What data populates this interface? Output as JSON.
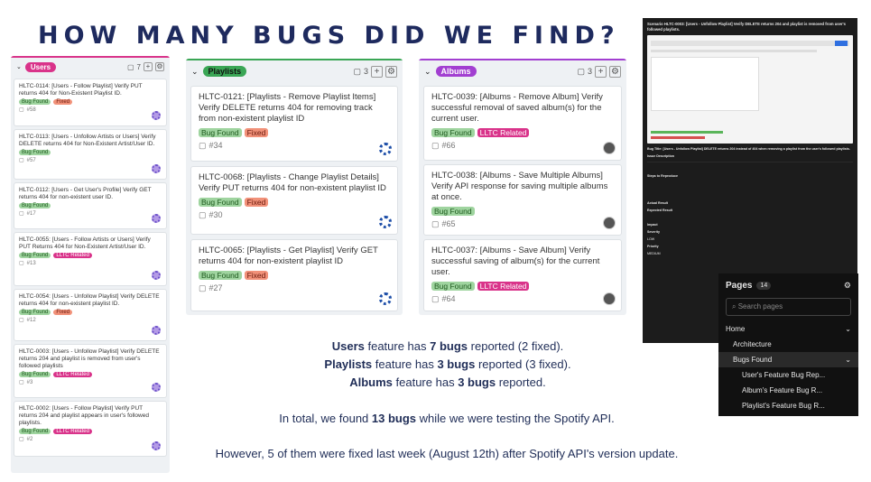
{
  "title": "HOW MANY BUGS DID WE FIND?",
  "columns": [
    {
      "label": "Users",
      "count": "7",
      "color": "#d9338a",
      "cards": [
        {
          "title": "HLTC-0114: [Users - Follow Playlist] Verify PUT returns 404 for Non-Existent Playlist ID.",
          "tags": [
            "Bug Found",
            "Fixed"
          ],
          "id": "#58"
        },
        {
          "title": "HLTC-0113: [Users - Unfollow Artists or Users] Verify DELETE returns 404 for Non-Existent Artist/User ID.",
          "tags": [
            "Bug Found"
          ],
          "id": "#57"
        },
        {
          "title": "HLTC-0112: [Users - Get User's Profile] Verify GET returns 404 for non-existent user ID.",
          "tags": [
            "Bug Found"
          ],
          "id": "#17"
        },
        {
          "title": "HLTC-0055: [Users - Follow Artists or Users] Verify PUT Returns 404 for Non-Existent Artist/User ID.",
          "tags": [
            "Bug Found",
            "LLTC Related"
          ],
          "id": "#13"
        },
        {
          "title": "HLTC-0054: [Users - Unfollow Playlist] Verify DELETE returns 404 for non-existent playlist ID.",
          "tags": [
            "Bug Found",
            "Fixed"
          ],
          "id": "#12"
        },
        {
          "title": "HLTC-0003: [Users - Unfollow Playlist] Verify DELETE returns 204 and playlist is removed from user's followed playlists",
          "tags": [
            "Bug Found",
            "LLTC Related"
          ],
          "id": "#3"
        },
        {
          "title": "HLTC-0002: [Users - Follow Playlist] Verify PUT returns 204 and playlist appears in user's followed playlists.",
          "tags": [
            "Bug Found",
            "LLTC Related"
          ],
          "id": "#2"
        }
      ]
    },
    {
      "label": "Playlists",
      "count": "3",
      "color": "#3aa655",
      "cards": [
        {
          "title": "HLTC-0121: [Playlists - Remove Playlist Items] Verify DELETE returns 404 for removing track from non-existent playlist ID",
          "tags": [
            "Bug Found",
            "Fixed"
          ],
          "id": "#34"
        },
        {
          "title": "HLTC-0068: [Playlists - Change Playlist Details] Verify PUT returns 404 for non-existent playlist ID",
          "tags": [
            "Bug Found",
            "Fixed"
          ],
          "id": "#30"
        },
        {
          "title": "HLTC-0065: [Playlists - Get Playlist] Verify GET returns 404 for non-existent playlist ID",
          "tags": [
            "Bug Found",
            "Fixed"
          ],
          "id": "#27"
        }
      ]
    },
    {
      "label": "Albums",
      "count": "3",
      "color": "#a23fd1",
      "cards": [
        {
          "title": "HLTC-0039: [Albums - Remove Album] Verify successful removal of saved album(s) for the current user.",
          "tags": [
            "Bug Found",
            "LLTC Related"
          ],
          "id": "#66"
        },
        {
          "title": "HLTC-0038: [Albums - Save Multiple Albums] Verify API response for saving multiple albums at once.",
          "tags": [
            "Bug Found"
          ],
          "id": "#65"
        },
        {
          "title": "HLTC-0037: [Albums - Save Album] Verify successful saving of album(s) for the current user.",
          "tags": [
            "Bug Found",
            "LLTC Related"
          ],
          "id": "#64"
        }
      ]
    }
  ],
  "summary": {
    "l1_a": "Users",
    "l1_b": " feature has ",
    "l1_c": "7 bugs",
    "l1_d": " reported (2 fixed).",
    "l2_a": "Playlists",
    "l2_b": " feature has ",
    "l2_c": "3 bugs",
    "l2_d": " reported (3 fixed).",
    "l3_a": "Albums",
    "l3_b": " feature has ",
    "l3_c": "3 bugs",
    "l3_d": " reported.",
    "l4_a": "In total, we found ",
    "l4_b": "13 bugs",
    "l4_c": " while we were testing the Spotify API.",
    "l5": "However, 5 of them were fixed last week (August 12th) after Spotify API's version update."
  },
  "doc": {
    "heading": "Scenario HLTC-0003: [Users - Unfollow Playlist] Verify DELETE returns 204 and playlist is removed from user's followed playlists.",
    "bug_title": "Bug Title: [Users - Unfollow Playlist] DELETE returns 204 instead of 404 when removing a playlist from the user's followed playlists.",
    "issue": "Issue Description",
    "steps": "Steps to Reproduce",
    "actual": "Actual Result",
    "expected": "Expected Result",
    "impact": "Impact",
    "severity": "Severity",
    "severity_val": "LOW",
    "priority": "Priority",
    "priority_val": "MEDIUM"
  },
  "pages": {
    "title": "Pages",
    "count": "14",
    "search": "Search pages",
    "items": [
      "Home",
      "Architecture",
      "Bugs Found",
      "User's Feature Bug Rep...",
      "Album's Feature Bug R...",
      "Playlist's Feature Bug R..."
    ]
  },
  "colors": {
    "bug": "#9fd49f",
    "fixed": "#f19179",
    "lltc": "#d9338a",
    "navy": "#1e2a5e"
  }
}
